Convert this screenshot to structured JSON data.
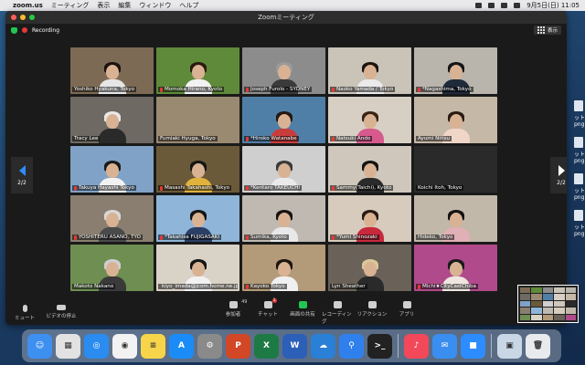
{
  "menubar": {
    "app_name": "zoom.us",
    "items": [
      "ミーティング",
      "表示",
      "編集",
      "ウィンドウ",
      "ヘルプ"
    ],
    "datetime": "9月5日(日) 11:05"
  },
  "window": {
    "title": "Zoomミーティング"
  },
  "topstrip": {
    "recording_label": "Recording",
    "view_label": "表示"
  },
  "pager": {
    "left": "2/2",
    "right": "2/2"
  },
  "participants": [
    {
      "name": "Yoshiko Hyakuna, Tokyo",
      "bg": "#7d6a55",
      "hair": "#1b120c",
      "shirt": "#e6e6e6",
      "muted": false
    },
    {
      "name": "Momoka Hirano, Kyoto",
      "bg": "#5f8a3a",
      "hair": "#2a1a10",
      "shirt": "#f2f2f2",
      "muted": true
    },
    {
      "name": "Joseph Furolo - SYDNEY",
      "bg": "#8c8c8c",
      "hair": "#9a9a9a",
      "shirt": "#3a3a3a",
      "muted": true
    },
    {
      "name": "Naoko Yamada / Tokyo",
      "bg": "#c9c3b8",
      "hair": "#1c1410",
      "shirt": "#eaeaea",
      "muted": true
    },
    {
      "name": "*Nagashima, Tokyo",
      "bg": "#b9b4ac",
      "hair": "#151515",
      "shirt": "#1f2a3a",
      "muted": true
    },
    {
      "name": "Tracy Lee",
      "bg": "#6e6a63",
      "hair": "#e8e8e8",
      "shirt": "#2a2a2a",
      "muted": false
    },
    {
      "name": "Fumiaki Hyuga, Tokyo",
      "bg": "#9b8a72",
      "hair": "#9b8a72",
      "shirt": "#9b8a72",
      "muted": false
    },
    {
      "name": "*Hiroko Watanabe",
      "bg": "#4f7fa6",
      "hair": "#241710",
      "shirt": "#c83c3c",
      "muted": true
    },
    {
      "name": "Natsuki Ando",
      "bg": "#d8cfc4",
      "hair": "#3a2414",
      "shirt": "#d65a8c",
      "muted": true
    },
    {
      "name": "Ayumi Niitsu",
      "bg": "#c6b8a6",
      "hair": "#2a1c12",
      "shirt": "#f0d6c6",
      "muted": false
    },
    {
      "name": "Takuya Hayashi Tokyo",
      "bg": "#7fa2c6",
      "hair": "#1a1a1a",
      "shirt": "#f2f2f2",
      "muted": true
    },
    {
      "name": "Masashi Takahashi, Tokyo",
      "bg": "#6b5a3a",
      "hair": "#151515",
      "shirt": "#e2b33c",
      "muted": true
    },
    {
      "name": "*Kentaro TAKEUCHI",
      "bg": "#cfcfcf",
      "hair": "#3a3a3a",
      "shirt": "#eaeaea",
      "muted": true
    },
    {
      "name": "Sammy(Taichi), Kyoto",
      "bg": "#cfc7bb",
      "hair": "#141414",
      "shirt": "#2a2a2a",
      "muted": true
    },
    {
      "name": "Koichi Itoh, Tokyo",
      "bg": "#2a2a2a",
      "hair": "#2a2a2a",
      "shirt": "#2a2a2a",
      "muted": false
    },
    {
      "name": "YOSHITERU ASANO, TYO",
      "bg": "#8a7e70",
      "hair": "#d8d8d8",
      "shirt": "#4a4a4a",
      "muted": true
    },
    {
      "name": "*Takahisa FUJIGASAKI",
      "bg": "#8fb5d8",
      "hair": "#151515",
      "shirt": "#2b3f66",
      "muted": true
    },
    {
      "name": "Sumika, Kyoto",
      "bg": "#bfb9b2",
      "hair": "#161210",
      "shirt": "#e8e8e8",
      "muted": true
    },
    {
      "name": "*Yumi Shinozaki",
      "bg": "#d6cbbc",
      "hair": "#2a1a12",
      "shirt": "#c8283c",
      "muted": true
    },
    {
      "name": "Hideko, Tokyo",
      "bg": "#c2b8aa",
      "hair": "#121212",
      "shirt": "#e0b0b6",
      "muted": false
    },
    {
      "name": "Makoto Nakano",
      "bg": "#6e8e52",
      "hair": "#cfcfcf",
      "shirt": "#3a3a3a",
      "muted": false
    },
    {
      "name": "kiyo_imada@jcom.home.ne.jp",
      "bg": "#d9d2c6",
      "hair": "#151515",
      "shirt": "#f2f2f2",
      "muted": true
    },
    {
      "name": "Kayoko Tokyo",
      "bg": "#b39a78",
      "hair": "#1e1410",
      "shirt": "#f0f0f0",
      "muted": true
    },
    {
      "name": "Lyn Sheather",
      "bg": "#6a6258",
      "hair": "#d9c89a",
      "shirt": "#2a2a2a",
      "muted": false
    },
    {
      "name": "Michi★CityCastChiba",
      "bg": "#b04a8a",
      "hair": "#1a1a1a",
      "shirt": "#efe6e0",
      "muted": true
    }
  ],
  "toolbar": {
    "mute": "ミュート",
    "video": "ビデオの停止",
    "participants": "参加者",
    "participants_count": "49",
    "chat": "チャット",
    "chat_badge": "1",
    "share": "画面の共有",
    "record": "レコーディング",
    "reactions": "リアクション",
    "apps": "アプリ"
  },
  "dock": [
    {
      "name": "finder-icon",
      "color": "#3d8ff0",
      "glyph": "☺"
    },
    {
      "name": "launchpad-icon",
      "color": "#e2e2e2",
      "glyph": "▦"
    },
    {
      "name": "safari-icon",
      "color": "#2a8cf0",
      "glyph": "◎"
    },
    {
      "name": "chrome-icon",
      "color": "#f2f2f2",
      "glyph": "◉"
    },
    {
      "name": "notes-icon",
      "color": "#f7d54a",
      "glyph": "≡"
    },
    {
      "name": "app-store-icon",
      "color": "#1b8cf7",
      "glyph": "A"
    },
    {
      "name": "system-preferences-icon",
      "color": "#8a8a8a",
      "glyph": "⚙"
    },
    {
      "name": "powerpoint-icon",
      "color": "#d24726",
      "glyph": "P"
    },
    {
      "name": "excel-icon",
      "color": "#1d7a45",
      "glyph": "X"
    },
    {
      "name": "word-icon",
      "color": "#2b5fb8",
      "glyph": "W"
    },
    {
      "name": "onedrive-icon",
      "color": "#2a7fd6",
      "glyph": "☁"
    },
    {
      "name": "find-my-icon",
      "color": "#2f80ed",
      "glyph": "⚲"
    },
    {
      "name": "terminal-icon",
      "color": "#222222",
      "glyph": ">_"
    },
    {
      "name": "music-icon",
      "color": "#f2485a",
      "glyph": "♪"
    },
    {
      "name": "mail-icon",
      "color": "#3a8ef0",
      "glyph": "✉"
    },
    {
      "name": "zoom-icon",
      "color": "#2d8cff",
      "glyph": "■"
    },
    {
      "name": "preview-icon",
      "color": "#c9d6e6",
      "glyph": "▣"
    },
    {
      "name": "trash-icon",
      "color": "#e8eaee",
      "glyph": "🗑"
    }
  ],
  "desktop_files": [
    "ット",
    "png",
    "ット",
    "png",
    "ット",
    "png",
    "ット",
    "png"
  ]
}
